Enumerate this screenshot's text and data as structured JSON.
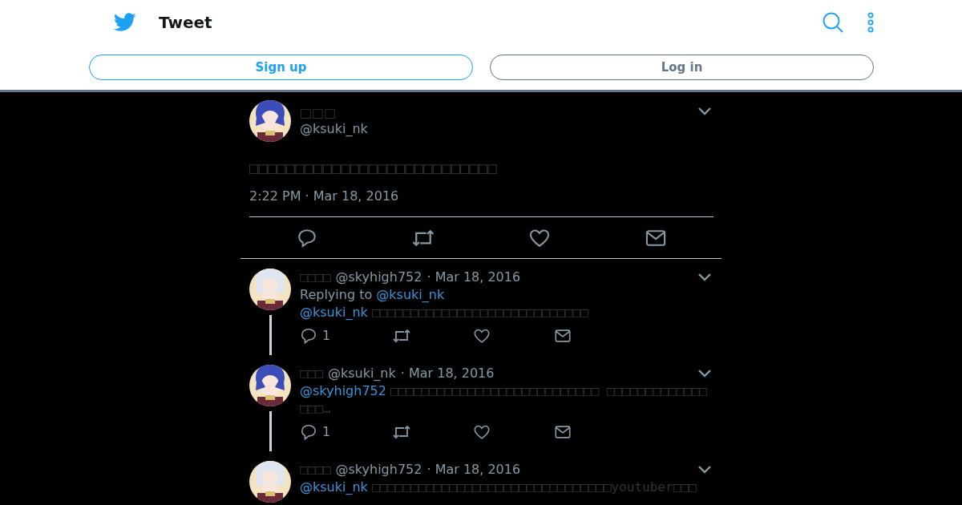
{
  "header": {
    "title": "Tweet",
    "buttons": [
      {
        "label": "Sign up",
        "kind": "primary"
      },
      {
        "label": "Log in",
        "kind": "secondary"
      }
    ]
  },
  "main_tweet": {
    "name": "□□□",
    "handle": "@ksuki_nk",
    "text": "□□□□□□□□□□□□□□□□□□□□□□□□□□□",
    "timestamp": "2:22 PM · Mar 18, 2016"
  },
  "replies": [
    {
      "name": "□□□□",
      "handle": "@skyhigh752",
      "date": "· Mar 18, 2016",
      "replying_label": "Replying to",
      "replying_to": "@ksuki_nk",
      "mention": "@ksuki_nk",
      "text": "□□□□□□□□□□□□□□□□□□□□□□□□□□□□",
      "reply_count": "1",
      "thread_continues": true
    },
    {
      "name": "□□□",
      "handle": "@ksuki_nk",
      "date": "· Mar 18, 2016",
      "mention": "@skyhigh752",
      "text": "□□□□□□□□□□□□□□□□□□□□□□□□□□□ □□□□□□□□□□□□□□□□…",
      "reply_count": "1",
      "thread_continues": true
    },
    {
      "name": "□□□□",
      "handle": "@skyhigh752",
      "date": "· Mar 18, 2016",
      "mention": "@ksuki_nk",
      "text": "□□□□□□□□□□□□□□□□□□□□□□□□□□□□□□□youtuber□□□",
      "thread_continues": false
    }
  ]
}
